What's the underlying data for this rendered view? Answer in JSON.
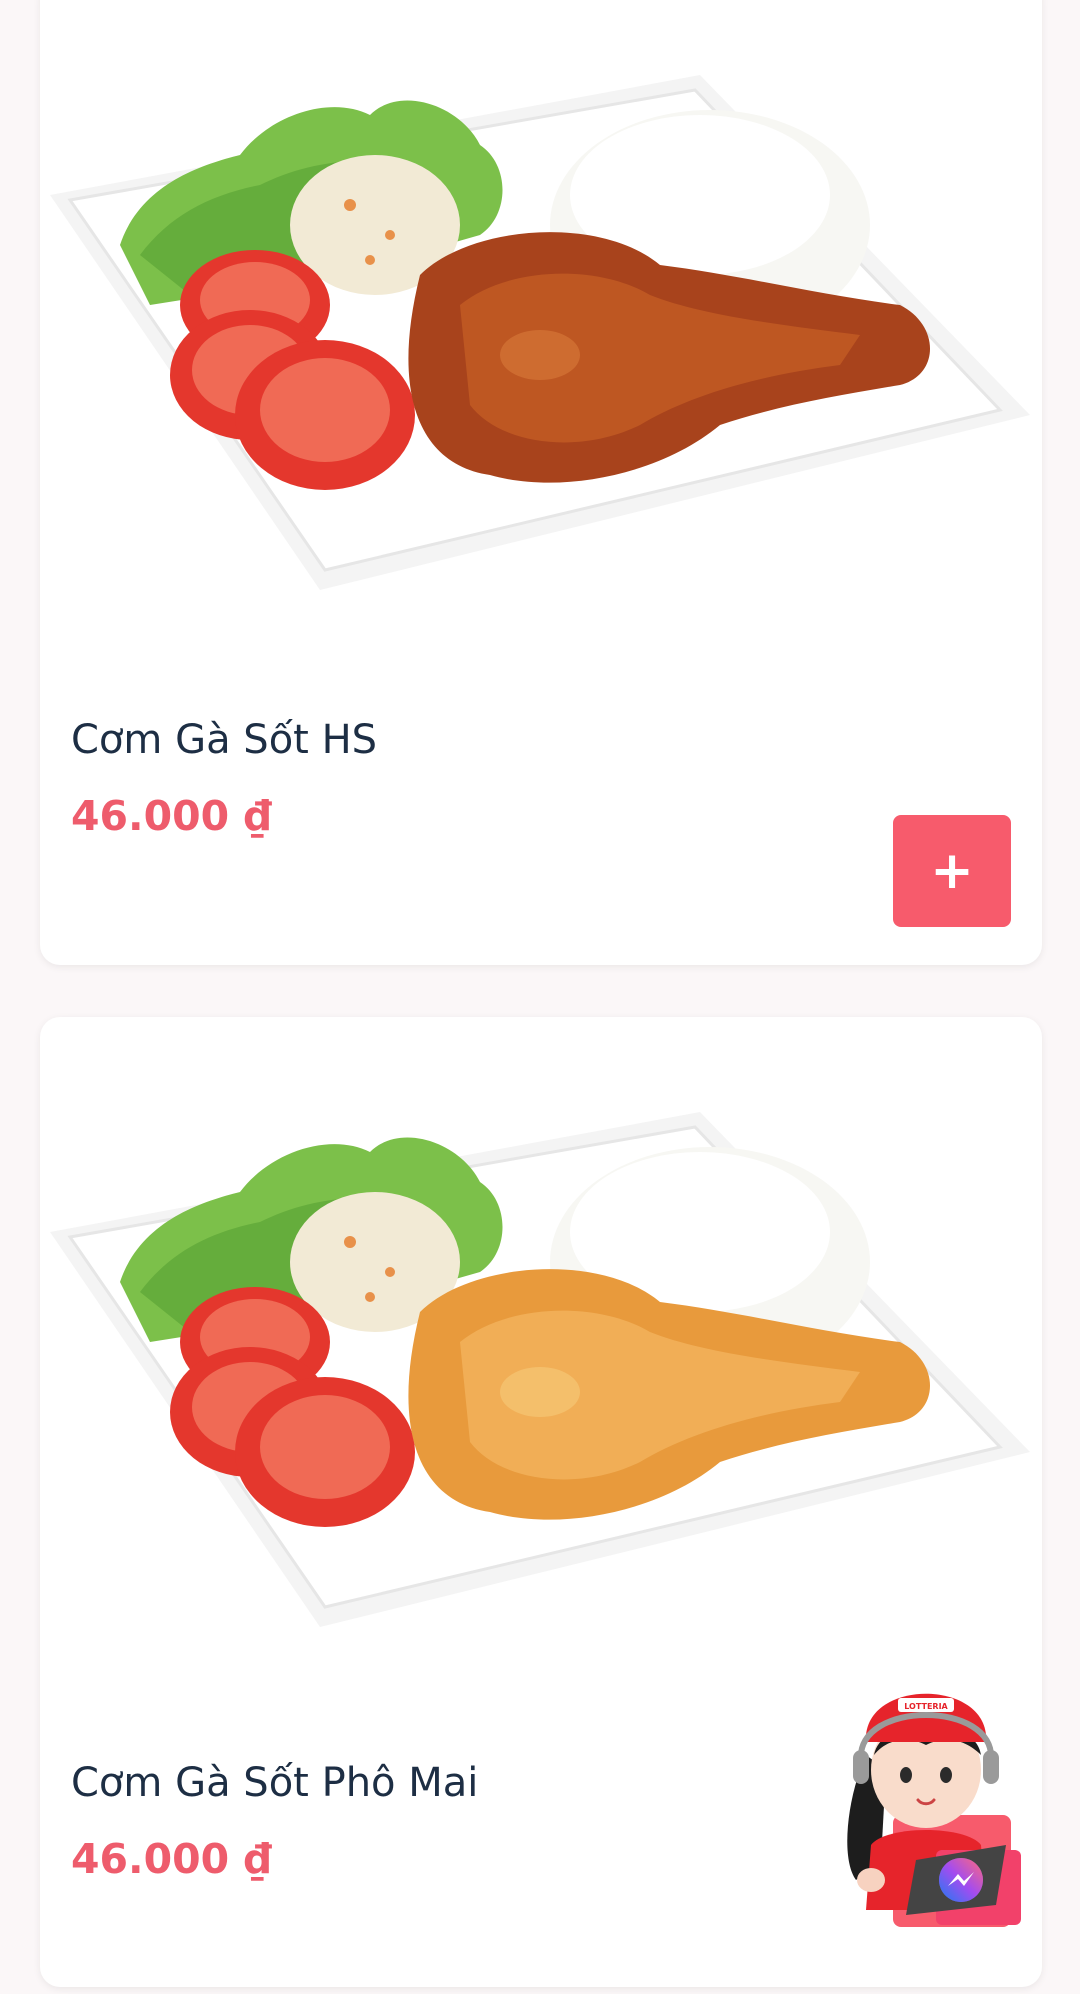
{
  "products": [
    {
      "name": "Cơm Gà Sốt HS",
      "price": "46.000 ₫",
      "add_label": "+",
      "image": "fried-chicken-rice-plate-dark-sauce"
    },
    {
      "name": "Cơm Gà Sốt Phô Mai",
      "price": "46.000 ₫",
      "add_label": "+",
      "image": "fried-chicken-rice-plate-cheese-sauce"
    }
  ],
  "chat_widget": {
    "mascot": "lotteria-staff-mascot",
    "cap_text": "LOTTERIA",
    "icon": "messenger-icon"
  },
  "colors": {
    "accent": "#f75b6c",
    "price": "#ee5c6c",
    "title": "#1d2e44",
    "sauce_hs": "#a8431c",
    "sauce_cheese": "#e89a3c"
  }
}
